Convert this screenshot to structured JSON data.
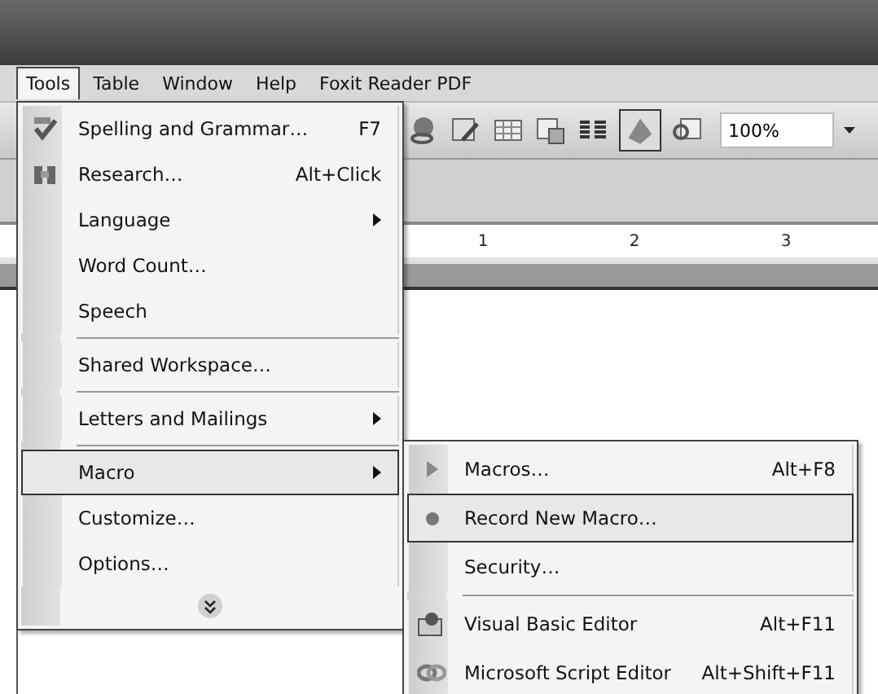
{
  "menubar": [
    {
      "label": "Tools",
      "selected": true
    },
    {
      "label": "Table",
      "selected": false
    },
    {
      "label": "Window",
      "selected": false
    },
    {
      "label": "Help",
      "selected": false
    },
    {
      "label": "Foxit Reader PDF",
      "selected": false
    }
  ],
  "toolbar": {
    "zoom": "100%"
  },
  "ruler": {
    "marks": [
      "1",
      "2",
      "3"
    ]
  },
  "tools_menu": {
    "items": [
      {
        "kind": "item",
        "label": "Spelling and Grammar…",
        "shortcut": "F7",
        "submenu": false,
        "selected": false
      },
      {
        "kind": "item",
        "label": "Research…",
        "shortcut": "Alt+Click",
        "submenu": false,
        "selected": false
      },
      {
        "kind": "item",
        "label": "Language",
        "submenu": true,
        "selected": false
      },
      {
        "kind": "item",
        "label": "Word Count…",
        "submenu": false,
        "selected": false
      },
      {
        "kind": "item",
        "label": "Speech",
        "submenu": false,
        "selected": false
      },
      {
        "kind": "separator"
      },
      {
        "kind": "item",
        "label": "Shared Workspace…",
        "submenu": false,
        "selected": false
      },
      {
        "kind": "separator"
      },
      {
        "kind": "item",
        "label": "Letters and Mailings",
        "submenu": true,
        "selected": false
      },
      {
        "kind": "separator"
      },
      {
        "kind": "item",
        "label": "Macro",
        "submenu": true,
        "selected": true
      },
      {
        "kind": "item",
        "label": "Customize…",
        "submenu": false,
        "selected": false
      },
      {
        "kind": "item",
        "label": "Options…",
        "submenu": false,
        "selected": false
      },
      {
        "kind": "expand"
      }
    ]
  },
  "macro_submenu": {
    "items": [
      {
        "kind": "item",
        "label": "Macros…",
        "shortcut": "Alt+F8",
        "selected": false
      },
      {
        "kind": "item",
        "label": "Record New Macro…",
        "selected": true
      },
      {
        "kind": "item",
        "label": "Security…",
        "selected": false
      },
      {
        "kind": "separator"
      },
      {
        "kind": "item",
        "label": "Visual Basic Editor",
        "shortcut": "Alt+F11",
        "selected": false
      },
      {
        "kind": "item",
        "label": "Microsoft Script Editor",
        "shortcut": "Alt+Shift+F11",
        "selected": false
      }
    ]
  }
}
